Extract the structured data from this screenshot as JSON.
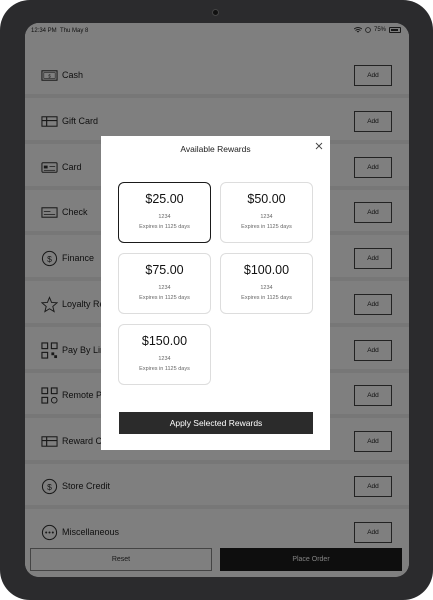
{
  "status": {
    "time": "12:34 PM",
    "date": "Thu May 8",
    "battery": "75%"
  },
  "payments": [
    {
      "label": "Cash",
      "icon": "cash-icon",
      "add": "Add"
    },
    {
      "label": "Gift Card",
      "icon": "gift-card-icon",
      "add": "Add"
    },
    {
      "label": "Card",
      "icon": "card-icon",
      "add": "Add"
    },
    {
      "label": "Check",
      "icon": "check-icon",
      "add": "Add"
    },
    {
      "label": "Finance",
      "icon": "finance-icon",
      "add": "Add"
    },
    {
      "label": "Loyalty Re",
      "icon": "loyalty-star-icon",
      "add": "Add"
    },
    {
      "label": "Pay By Lin",
      "icon": "qr-code-icon",
      "add": "Add"
    },
    {
      "label": "Remote P",
      "icon": "remote-qr-icon",
      "add": "Add"
    },
    {
      "label": "Reward C",
      "icon": "reward-card-icon",
      "add": "Add"
    },
    {
      "label": "Store Credit",
      "icon": "store-credit-icon",
      "add": "Add"
    },
    {
      "label": "Miscellaneous",
      "icon": "more-icon",
      "add": "Add"
    }
  ],
  "footer": {
    "reset": "Reset",
    "place_order": "Place Order"
  },
  "modal": {
    "title": "Available Rewards",
    "close_icon": "close-icon",
    "rewards": [
      {
        "amount": "$25.00",
        "code": "1234",
        "expires": "Expires in 1125 days",
        "selected": true
      },
      {
        "amount": "$50.00",
        "code": "1234",
        "expires": "Expires in 1125 days",
        "selected": false
      },
      {
        "amount": "$75.00",
        "code": "1234",
        "expires": "Expires in 1125 days",
        "selected": false
      },
      {
        "amount": "$100.00",
        "code": "1234",
        "expires": "Expires in 1125 days",
        "selected": false
      },
      {
        "amount": "$150.00",
        "code": "1234",
        "expires": "Expires in 1125 days",
        "selected": false
      }
    ],
    "apply": "Apply Selected Rewards"
  }
}
